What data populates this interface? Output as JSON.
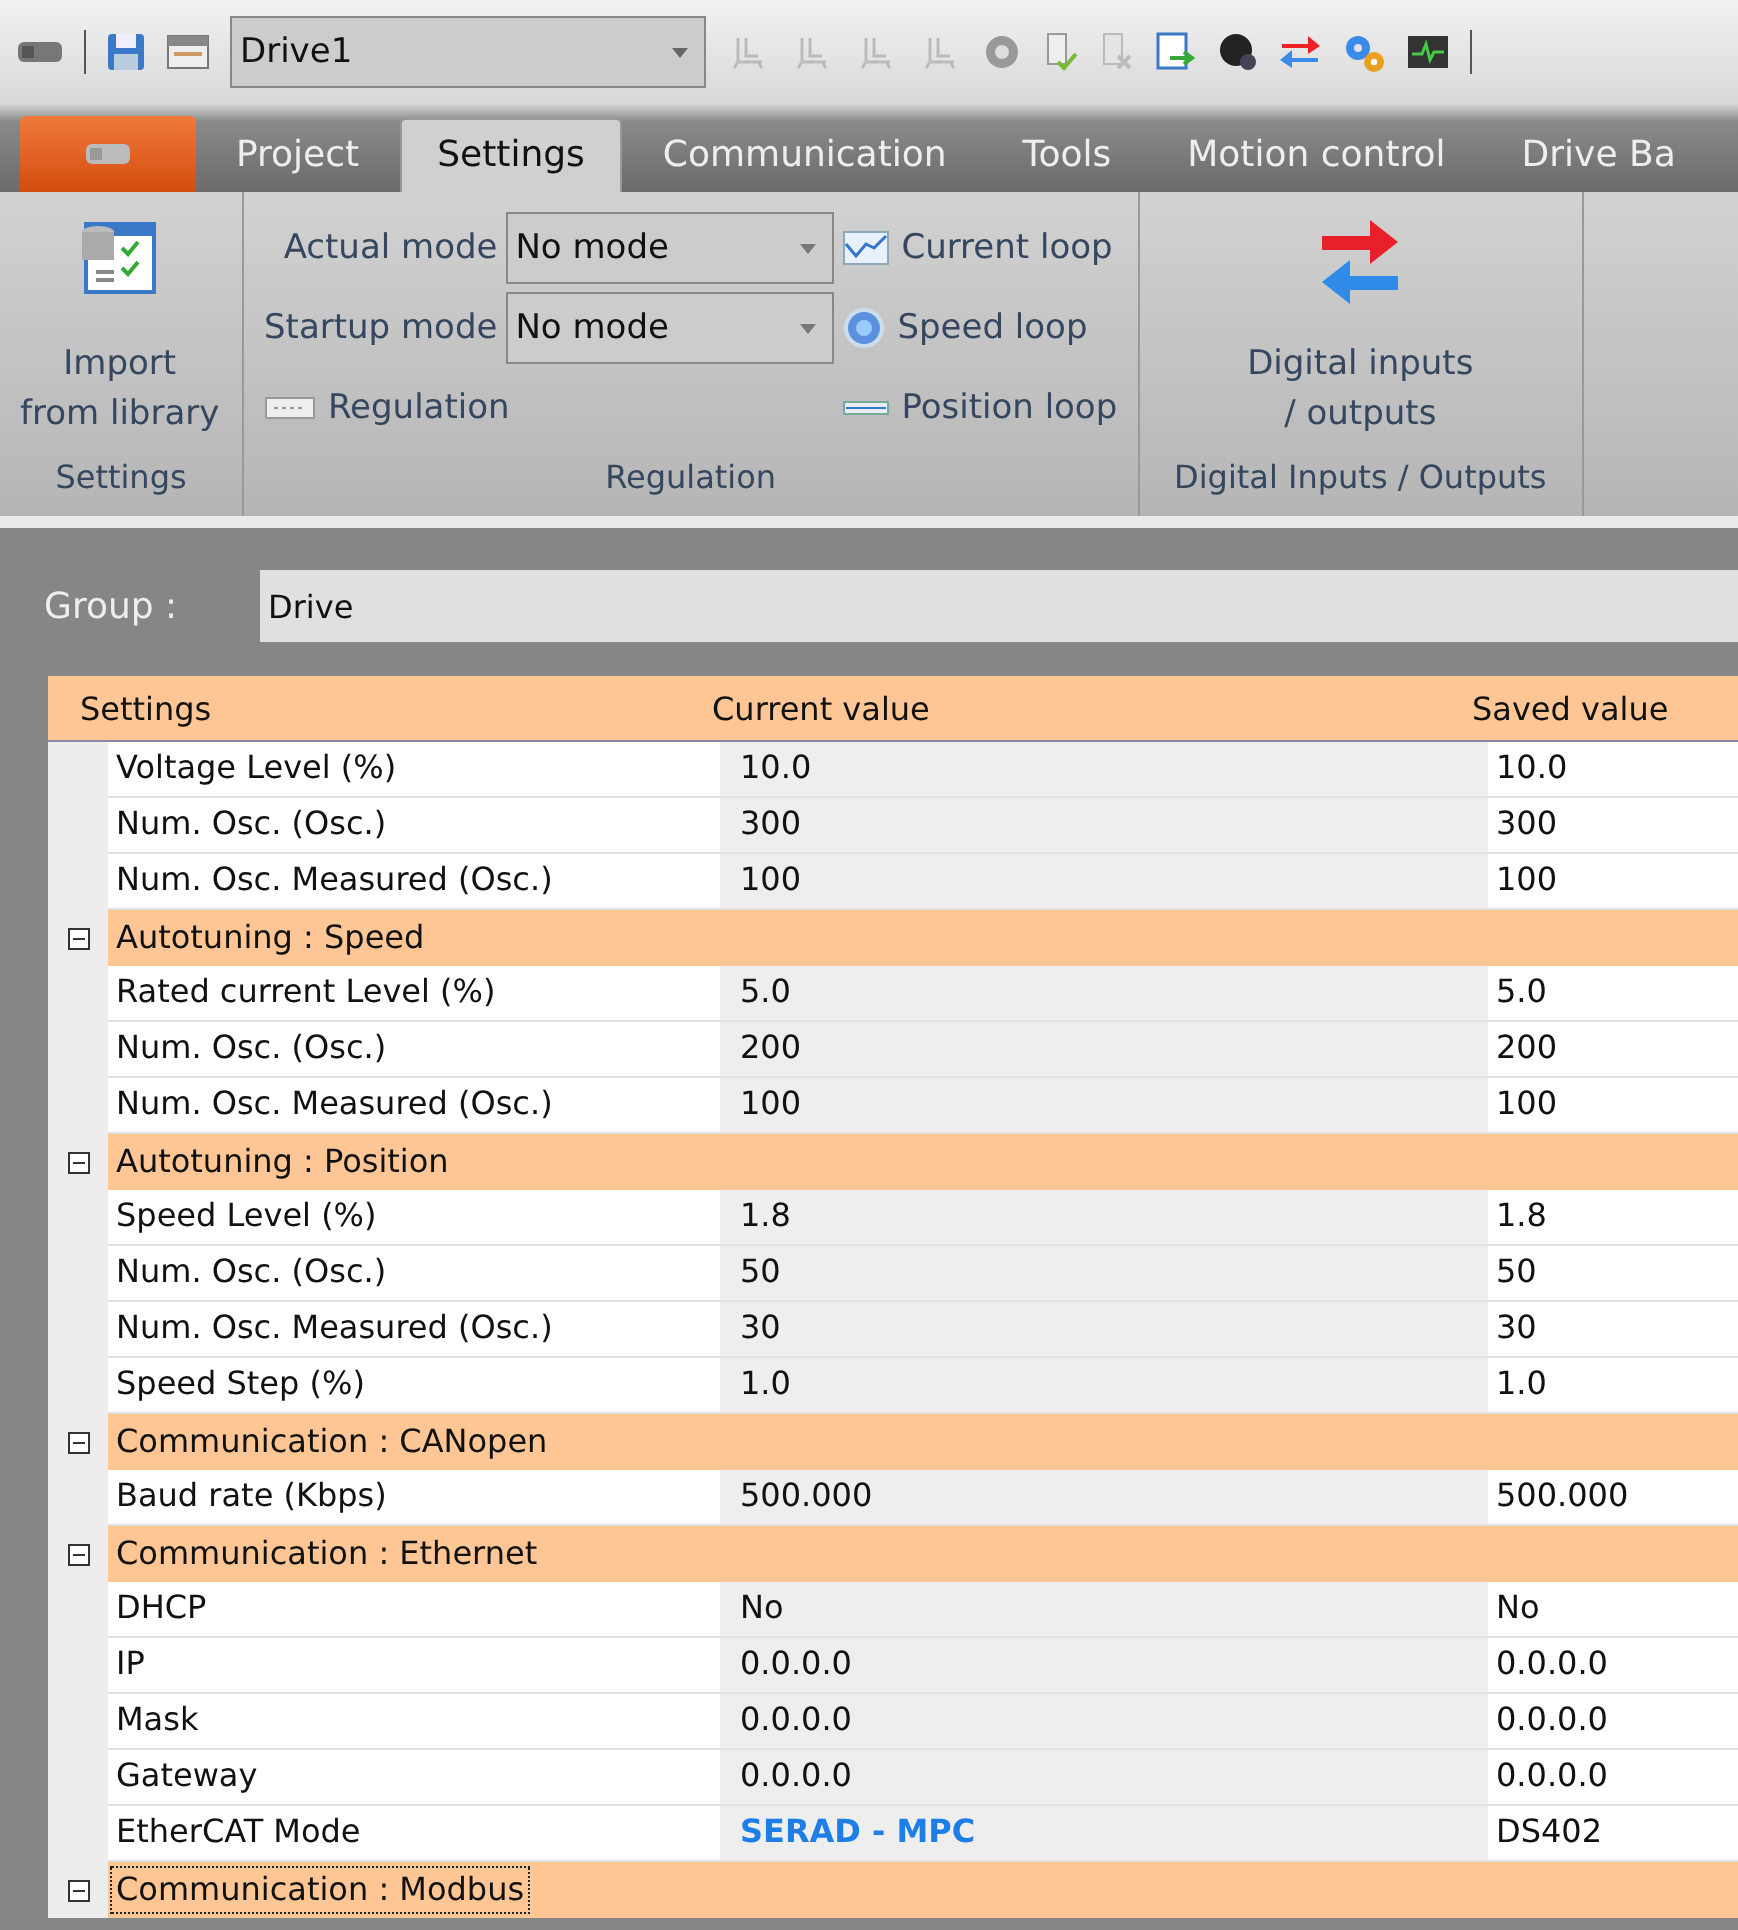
{
  "toolbar": {
    "document": "Drive1"
  },
  "tabs": [
    {
      "label": "Project",
      "selected": false
    },
    {
      "label": "Settings",
      "selected": true
    },
    {
      "label": "Communication",
      "selected": false
    },
    {
      "label": "Tools",
      "selected": false
    },
    {
      "label": "Motion control",
      "selected": false
    },
    {
      "label": "Drive Ba",
      "selected": false
    }
  ],
  "ribbon": [
    {
      "title": "Settings",
      "kind": "large",
      "label": "Import\nfrom library"
    },
    {
      "title": "Regulation",
      "kind": "regulation",
      "fields": [
        {
          "label": "Actual mode",
          "value": "No mode"
        },
        {
          "label": "Startup mode",
          "value": "No mode"
        }
      ],
      "extra": "Regulation",
      "buttons": [
        {
          "label": "Current loop"
        },
        {
          "label": "Speed loop"
        },
        {
          "label": "Position loop"
        }
      ]
    },
    {
      "title": "Digital Inputs / Outputs",
      "kind": "large",
      "label": "Digital inputs\n/ outputs"
    }
  ],
  "group": {
    "label": "Group :",
    "value": "Drive"
  },
  "table": {
    "columns": [
      "Settings",
      "Current value",
      "Saved value"
    ],
    "rows": [
      {
        "kind": "setting",
        "name": "Voltage Level (%)",
        "current": "10.0",
        "saved": "10.0"
      },
      {
        "kind": "setting",
        "name": "Num. Osc. (Osc.)",
        "current": "300",
        "saved": "300"
      },
      {
        "kind": "setting",
        "name": "Num. Osc. Measured (Osc.)",
        "current": "100",
        "saved": "100"
      },
      {
        "kind": "section",
        "title": "Autotuning : Speed",
        "expanded": true
      },
      {
        "kind": "setting",
        "name": "Rated current Level (%)",
        "current": "5.0",
        "saved": "5.0"
      },
      {
        "kind": "setting",
        "name": "Num. Osc. (Osc.)",
        "current": "200",
        "saved": "200"
      },
      {
        "kind": "setting",
        "name": "Num. Osc. Measured (Osc.)",
        "current": "100",
        "saved": "100"
      },
      {
        "kind": "section",
        "title": "Autotuning : Position",
        "expanded": true
      },
      {
        "kind": "setting",
        "name": "Speed Level (%)",
        "current": "1.8",
        "saved": "1.8"
      },
      {
        "kind": "setting",
        "name": "Num. Osc. (Osc.)",
        "current": "50",
        "saved": "50"
      },
      {
        "kind": "setting",
        "name": "Num. Osc. Measured (Osc.)",
        "current": "30",
        "saved": "30"
      },
      {
        "kind": "setting",
        "name": "Speed Step (%)",
        "current": "1.0",
        "saved": "1.0"
      },
      {
        "kind": "section",
        "title": "Communication : CANopen",
        "expanded": true
      },
      {
        "kind": "setting",
        "name": "Baud rate (Kbps)",
        "current": "500.000",
        "saved": "500.000"
      },
      {
        "kind": "section",
        "title": "Communication : Ethernet",
        "expanded": true
      },
      {
        "kind": "setting",
        "name": "DHCP",
        "current": "No",
        "saved": "No"
      },
      {
        "kind": "setting",
        "name": "IP",
        "current": "0.0.0.0",
        "saved": "0.0.0.0"
      },
      {
        "kind": "setting",
        "name": "Mask",
        "current": "0.0.0.0",
        "saved": "0.0.0.0"
      },
      {
        "kind": "setting",
        "name": "Gateway",
        "current": "0.0.0.0",
        "saved": "0.0.0.0"
      },
      {
        "kind": "setting",
        "name": "EtherCAT Mode",
        "current": "SERAD - MPC",
        "saved": "DS402",
        "highlight": true
      },
      {
        "kind": "section",
        "title": "Communication : Modbus",
        "expanded": true,
        "focused": true
      }
    ]
  }
}
